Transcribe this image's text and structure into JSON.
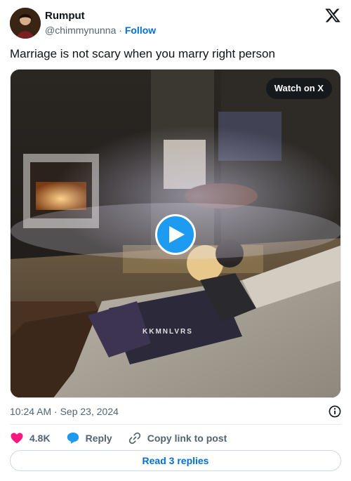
{
  "author": {
    "display_name": "Rumput",
    "handle": "@chimmynunna",
    "separator": "·",
    "follow_label": "Follow",
    "avatar_icon": "avatar-photo"
  },
  "brand": {
    "logo_icon": "x-logo-icon"
  },
  "tweet": {
    "text": "Marriage is not scary when you marry right person",
    "timestamp": "10:24 AM · Sep 23, 2024"
  },
  "media": {
    "watch_label": "Watch on X",
    "watermark": "KKMNLVRS",
    "play_icon": "play-icon"
  },
  "actions": {
    "like_count": "4.8K",
    "reply_label": "Reply",
    "copy_label": "Copy link to post",
    "like_color": "#f91880",
    "reply_color": "#1d9bf0"
  },
  "footer": {
    "read_replies_label": "Read 3 replies"
  },
  "colors": {
    "accent": "#1d9bf0",
    "link": "#006fd6",
    "muted": "#536471"
  }
}
